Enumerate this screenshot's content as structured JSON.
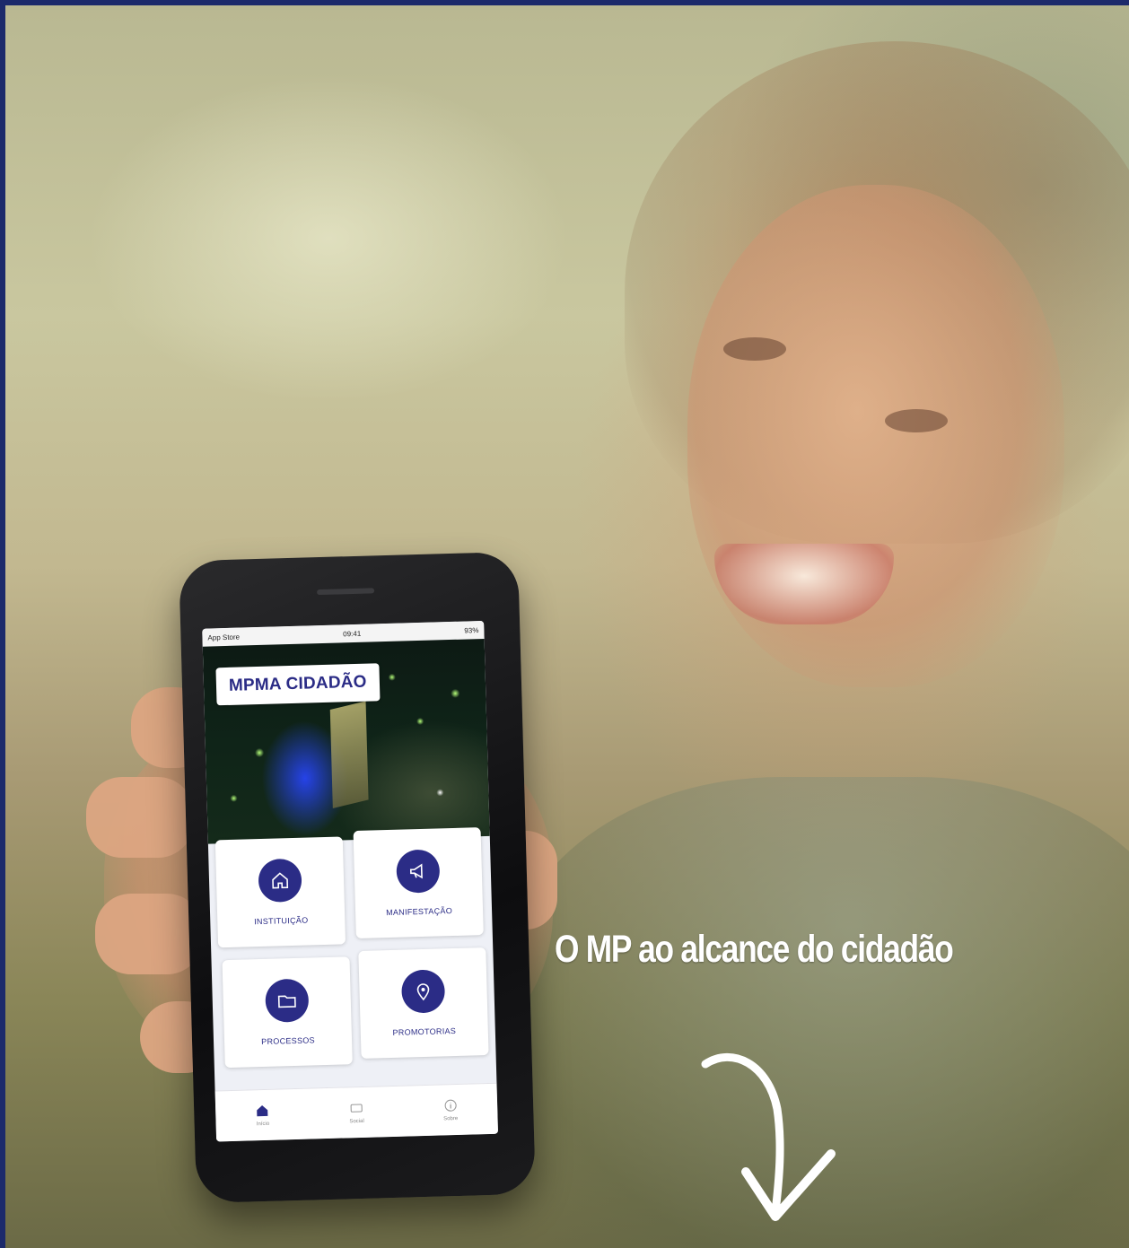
{
  "phone": {
    "statusbar": {
      "carrier": "App Store",
      "time": "09:41",
      "battery": "93%"
    },
    "app_title": "MPMA CIDADÃO",
    "menu": [
      {
        "label": "INSTITUIÇÃO",
        "icon": "home-icon"
      },
      {
        "label": "MANIFESTAÇÃO",
        "icon": "megaphone-icon"
      },
      {
        "label": "PROCESSOS",
        "icon": "folder-icon"
      },
      {
        "label": "PROMOTORIAS",
        "icon": "location-pin-icon"
      }
    ],
    "tabs": [
      {
        "label": "Início",
        "icon": "home-icon"
      },
      {
        "label": "Social",
        "icon": "social-icon"
      },
      {
        "label": "Sobre",
        "icon": "info-icon"
      }
    ]
  },
  "tagline": "O MP ao alcance do cidadão",
  "colors": {
    "brand": "#2b2c86",
    "frame": "#1c2a6b"
  }
}
